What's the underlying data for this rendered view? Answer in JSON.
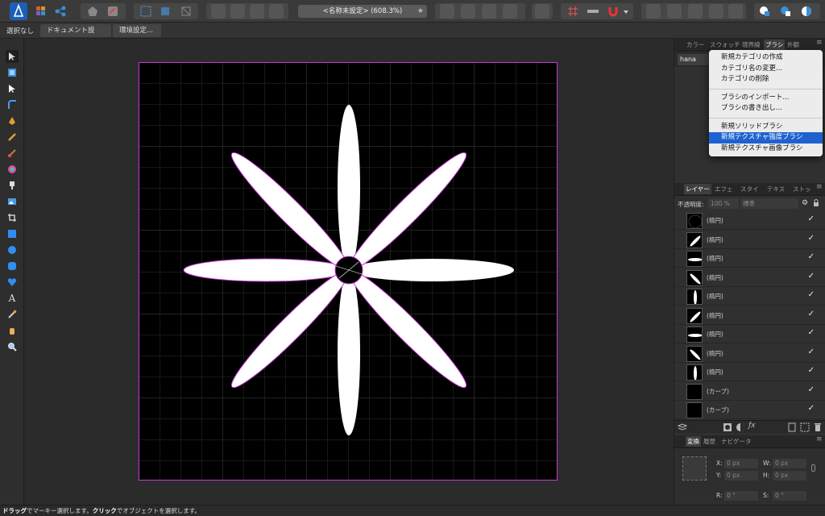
{
  "toolbar": {
    "document_title": "<名称未設定> (608.3%)",
    "favorite_symbol": "★"
  },
  "contextbar": {
    "selection_label": "選択なし",
    "document_setup_button": "ドキュメント設定...",
    "preferences_button": "環境設定..."
  },
  "panels": {
    "top_tabs": [
      "カラー",
      "スウォッチ",
      "境界線",
      "ブラシ",
      "外観"
    ],
    "brush_category": "hana",
    "layer_tabs": [
      "レイヤー",
      "エフェ",
      "スタイ",
      "テキス",
      "ストッ"
    ],
    "opacity_label": "不透明度:",
    "opacity_value": "100 %",
    "blend_mode": "標準",
    "bottom_tabs": [
      "変換",
      "履歴",
      "ナビゲータ"
    ]
  },
  "menu": {
    "items": [
      "新規カテゴリの作成",
      "カテゴリ名の変更...",
      "カテゴリの削除",
      "ブラシのインポート...",
      "ブラシの書き出し...",
      "新規ソリッドブラシ",
      "新規テクスチャ強度ブラシ",
      "新規テクスチャ画像ブラシ"
    ],
    "highlighted_index": 6
  },
  "layers": [
    {
      "name": "(楕円)",
      "thumb": "circle",
      "checked": "✓"
    },
    {
      "name": "(楕円)",
      "thumb": "diag-up",
      "checked": "✓"
    },
    {
      "name": "(楕円)",
      "thumb": "horizontal",
      "checked": "✓"
    },
    {
      "name": "(楕円)",
      "thumb": "diag-down",
      "checked": "✓"
    },
    {
      "name": "(楕円)",
      "thumb": "vertical",
      "checked": "✓"
    },
    {
      "name": "(楕円)",
      "thumb": "diag-up",
      "checked": "✓"
    },
    {
      "name": "(楕円)",
      "thumb": "horizontal",
      "checked": "✓"
    },
    {
      "name": "(楕円)",
      "thumb": "diag-down",
      "checked": "✓"
    },
    {
      "name": "(楕円)",
      "thumb": "vertical",
      "checked": "✓"
    },
    {
      "name": "(カーブ)",
      "thumb": "empty",
      "checked": "✓"
    },
    {
      "name": "(カーブ)",
      "thumb": "empty",
      "checked": "✓"
    }
  ],
  "transform": {
    "x_label": "X:",
    "x_value": "0 px",
    "y_label": "Y:",
    "y_value": "0 px",
    "w_label": "W:",
    "w_value": "0 px",
    "h_label": "H:",
    "h_value": "0 px",
    "r_label": "R:",
    "r_value": "0 °",
    "s_label": "S:",
    "s_value": "0 °"
  },
  "status": {
    "drag": "ドラッグ",
    "drag_desc": "でマーキー選択します。",
    "click": "クリック",
    "click_desc": "でオブジェクトを選択します。"
  },
  "colors": {
    "artboard_border": "#c43bd0",
    "selection_highlight": "#1e62d0",
    "flower_fill": "#ffffff",
    "canvas_bg": "#000000"
  }
}
